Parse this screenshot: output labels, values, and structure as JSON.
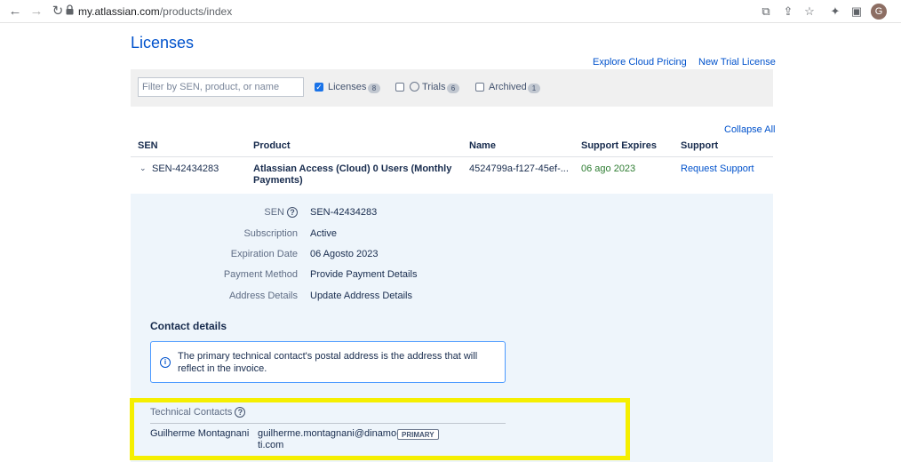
{
  "browser": {
    "url_host": "my.atlassian.com",
    "url_path": "/products/index",
    "avatar_letter": "G"
  },
  "page": {
    "title": "Licenses",
    "explore_link": "Explore Cloud Pricing",
    "trial_link": "New Trial License"
  },
  "filters": {
    "search_placeholder": "Filter by SEN, product, or name",
    "licenses": {
      "label": "Licenses",
      "count": "8",
      "checked": true
    },
    "trials": {
      "label": "Trials",
      "count": "6",
      "checked": false
    },
    "archived": {
      "label": "Archived",
      "count": "1",
      "checked": false
    }
  },
  "table": {
    "collapse_all": "Collapse All",
    "headers": [
      "SEN",
      "Product",
      "Name",
      "Support Expires",
      "Support"
    ],
    "row": {
      "sen": "SEN-42434283",
      "product": "Atlassian Access (Cloud) 0 Users (Monthly Payments)",
      "name": "4524799a-f127-45ef-...",
      "support_expires": "06 ago 2023",
      "support": "Request Support"
    }
  },
  "details": {
    "rows": [
      {
        "label": "SEN",
        "value": "SEN-42434283"
      },
      {
        "label": "Subscription",
        "value": "Active"
      },
      {
        "label": "Expiration Date",
        "value": "06 Agosto 2023"
      },
      {
        "label": "Payment Method",
        "value": "Provide Payment Details"
      },
      {
        "label": "Address Details",
        "value": "Update Address Details"
      }
    ]
  },
  "contact": {
    "title": "Contact details",
    "info": "The primary technical contact's postal address is the address that will reflect in the invoice.",
    "tech_label": "Technical Contacts",
    "name": "Guilherme Montagnani",
    "email": "guilherme.montagnani@dinamo-ti.com",
    "badge": "PRIMARY"
  },
  "colors": {
    "accent": "#0052cc",
    "highlight": "#f5ef00",
    "success": "#2e7d32"
  }
}
